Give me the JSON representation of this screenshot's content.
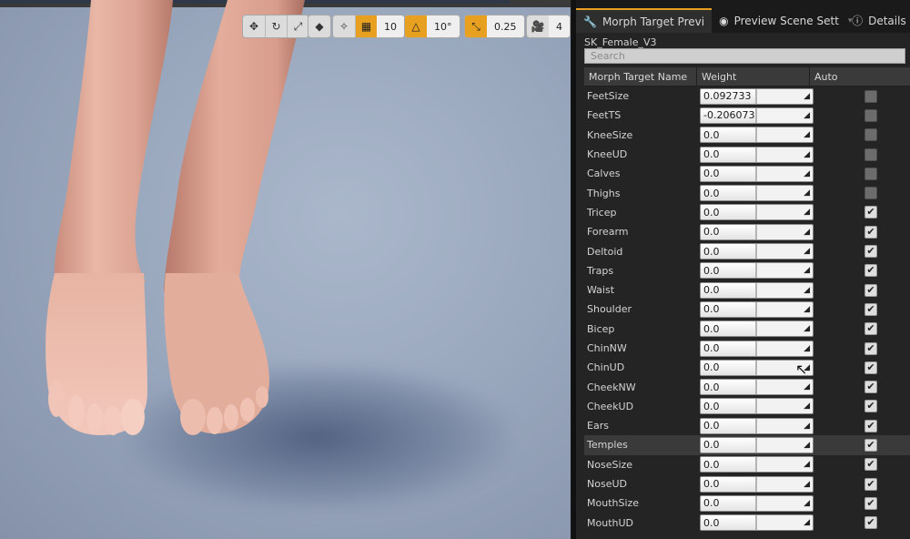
{
  "viewport": {
    "toolbar": {
      "transform_icons": [
        "move-icon",
        "rotate-icon",
        "scale-icon"
      ],
      "grid_snap_value": "10",
      "rotation_snap_value": "10°",
      "scale_snap_value": "0.25",
      "camera_speed_value": "4"
    }
  },
  "tabs": [
    {
      "label": "Morph Target Previ"
    },
    {
      "label": "Preview Scene Sett"
    },
    {
      "label": "Details"
    }
  ],
  "asset_name": "SK_Female_V3",
  "search": {
    "placeholder": "Search"
  },
  "list": {
    "headers": {
      "name": "Morph Target Name",
      "weight": "Weight",
      "auto": "Auto"
    },
    "rows": [
      {
        "name": "FeetSize",
        "weight": "0.092733",
        "auto": false
      },
      {
        "name": "FeetTS",
        "weight": "-0.206073",
        "auto": false
      },
      {
        "name": "KneeSize",
        "weight": "0.0",
        "auto": false
      },
      {
        "name": "KneeUD",
        "weight": "0.0",
        "auto": false
      },
      {
        "name": "Calves",
        "weight": "0.0",
        "auto": false
      },
      {
        "name": "Thighs",
        "weight": "0.0",
        "auto": false
      },
      {
        "name": "Tricep",
        "weight": "0.0",
        "auto": true
      },
      {
        "name": "Forearm",
        "weight": "0.0",
        "auto": true
      },
      {
        "name": "Deltoid",
        "weight": "0.0",
        "auto": true
      },
      {
        "name": "Traps",
        "weight": "0.0",
        "auto": true
      },
      {
        "name": "Waist",
        "weight": "0.0",
        "auto": true
      },
      {
        "name": "Shoulder",
        "weight": "0.0",
        "auto": true
      },
      {
        "name": "Bicep",
        "weight": "0.0",
        "auto": true
      },
      {
        "name": "ChinNW",
        "weight": "0.0",
        "auto": true
      },
      {
        "name": "ChinUD",
        "weight": "0.0",
        "auto": true
      },
      {
        "name": "CheekNW",
        "weight": "0.0",
        "auto": true
      },
      {
        "name": "CheekUD",
        "weight": "0.0",
        "auto": true
      },
      {
        "name": "Ears",
        "weight": "0.0",
        "auto": true
      },
      {
        "name": "Temples",
        "weight": "0.0",
        "auto": true,
        "highlighted": true
      },
      {
        "name": "NoseSize",
        "weight": "0.0",
        "auto": true
      },
      {
        "name": "NoseUD",
        "weight": "0.0",
        "auto": true
      },
      {
        "name": "MouthSize",
        "weight": "0.0",
        "auto": true
      },
      {
        "name": "MouthUD",
        "weight": "0.0",
        "auto": true
      }
    ]
  },
  "colors": {
    "accent": "#e8a020",
    "panel_bg": "#242424",
    "viewport_bg": "#9aa8be"
  }
}
